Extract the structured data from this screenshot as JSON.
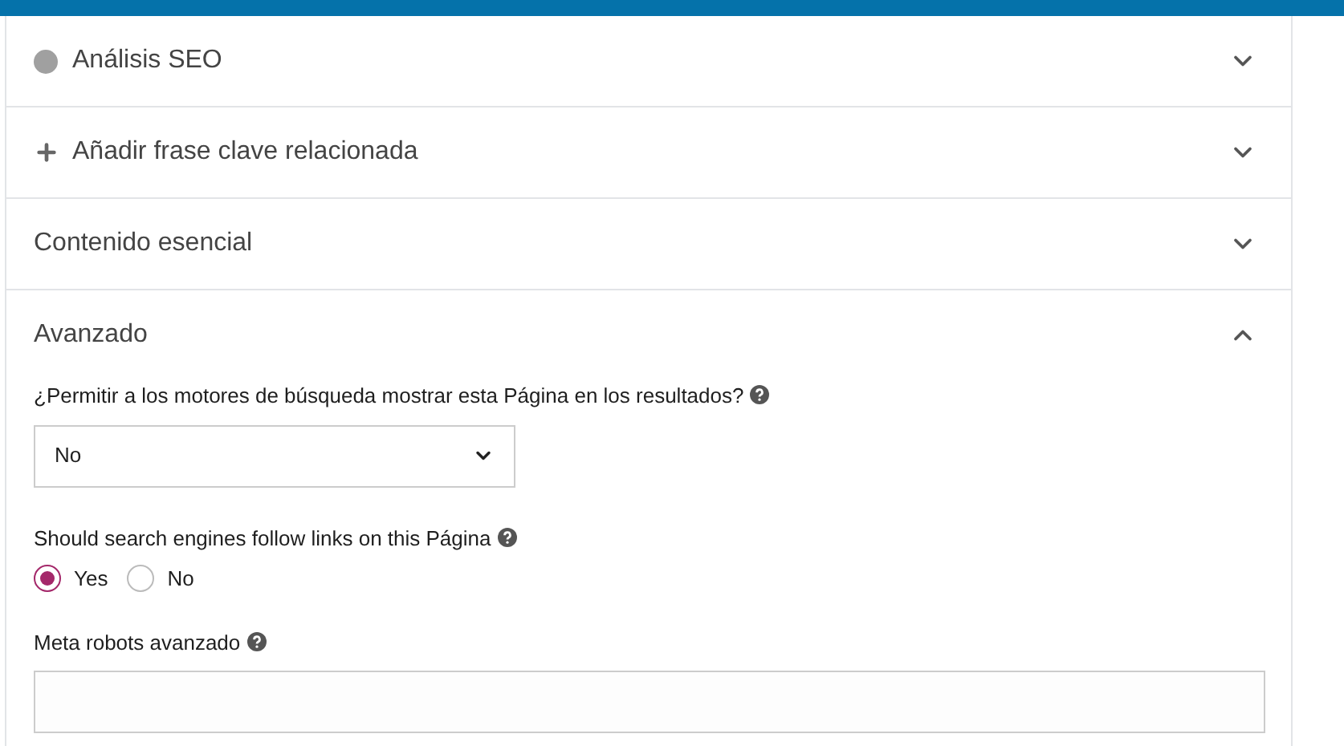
{
  "sections": [
    {
      "kind": "dot",
      "title": "Análisis SEO",
      "expanded": false
    },
    {
      "kind": "plus",
      "title": "Añadir frase clave relacionada",
      "expanded": false
    },
    {
      "kind": "plain",
      "title": "Contenido esencial",
      "expanded": false
    },
    {
      "kind": "plain",
      "title": "Avanzado",
      "expanded": true
    }
  ],
  "advanced": {
    "index_question": {
      "label": "¿Permitir a los motores de búsqueda mostrar esta Página en los resultados?",
      "value": "No"
    },
    "follow_question": {
      "label": "Should search engines follow links on this Página",
      "options": [
        {
          "label": "Yes",
          "selected": true
        },
        {
          "label": "No",
          "selected": false
        }
      ]
    },
    "meta_robots": {
      "label": "Meta robots avanzado"
    }
  }
}
